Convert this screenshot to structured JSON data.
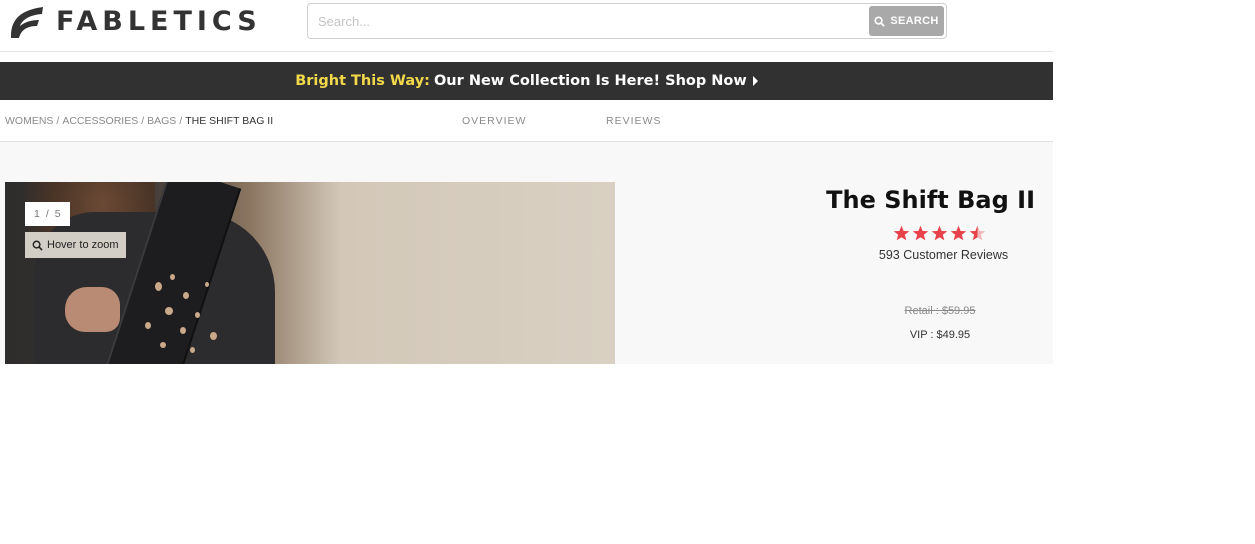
{
  "header": {
    "logo_text": "FABLETICS",
    "search": {
      "placeholder": "Search...",
      "value": "",
      "button_label": "SEARCH"
    }
  },
  "promo": {
    "highlight": "Bright This Way:",
    "text": "Our New Collection Is Here! Shop Now"
  },
  "breadcrumb": {
    "items": [
      "WOMENS",
      "ACCESSORIES",
      "BAGS"
    ],
    "current": "THE SHIFT BAG II"
  },
  "subnav": {
    "tabs": [
      "OVERVIEW",
      "REVIEWS"
    ]
  },
  "gallery": {
    "counter_current": "1",
    "counter_separator": "/",
    "counter_total": "5",
    "zoom_hint": "Hover to zoom"
  },
  "product": {
    "title": "The Shift Bag II",
    "rating": 4.5,
    "rating_max": 5,
    "reviews_text": "593 Customer Reviews",
    "retail_price": "Retail : $59.95",
    "vip_price": "VIP : $49.95"
  },
  "colors": {
    "promo_bg": "#313131",
    "promo_highlight": "#f2d94a",
    "star": "#e8424a",
    "search_button": "#a9a9a9"
  }
}
